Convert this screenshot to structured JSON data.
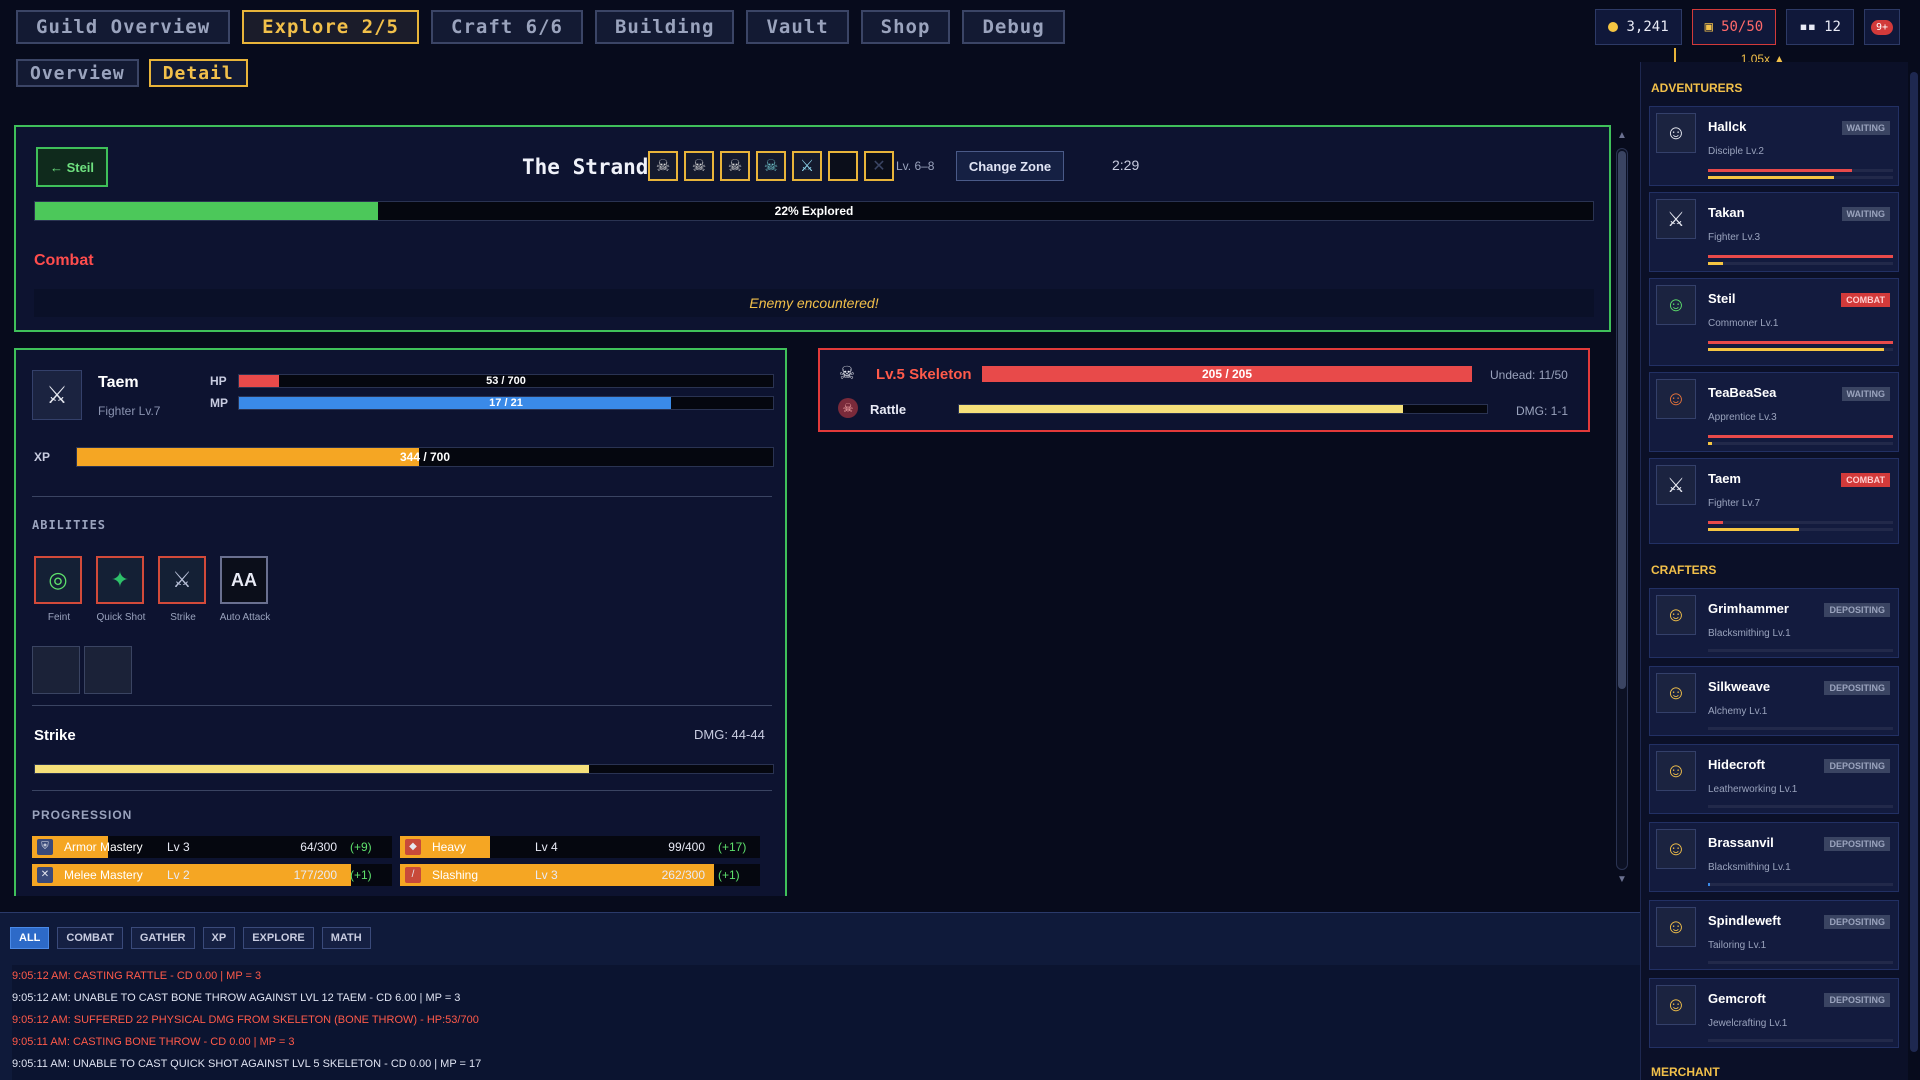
{
  "nav": {
    "tabs": [
      {
        "label": "Guild Overview",
        "active": false
      },
      {
        "label": "Explore 2/5",
        "active": true
      },
      {
        "label": "Craft 6/6",
        "active": false
      },
      {
        "label": "Building",
        "active": false
      },
      {
        "label": "Vault",
        "active": false
      },
      {
        "label": "Shop",
        "active": false
      },
      {
        "label": "Debug",
        "active": false
      }
    ],
    "subtabs": [
      {
        "label": "Overview",
        "active": false
      },
      {
        "label": "Detail",
        "active": true
      }
    ]
  },
  "resources": {
    "gold": "3,241",
    "storage": "50/50",
    "members": "12",
    "notifications": "9+",
    "multiplier": "1.05x ▲"
  },
  "explore": {
    "back_label": "← Steil",
    "zone_name": "The Strand",
    "zone_level": "Lv. 6–8",
    "change_zone_label": "Change Zone",
    "timer": "2:29",
    "explored_pct": 22,
    "explored_label": "22% Explored",
    "state_label": "Combat",
    "event_text": "Enemy encountered!",
    "monster_slots": [
      "skeleton-icon",
      "skeleton-icon",
      "skeleton-icon",
      "ghoul-icon",
      "sword-icon",
      "empty",
      "empty-x"
    ]
  },
  "hero": {
    "name": "Taem",
    "class": "Fighter Lv.7",
    "hp": {
      "label": "HP",
      "current": 53,
      "max": 700,
      "text": "53 / 700"
    },
    "mp": {
      "label": "MP",
      "current": 17,
      "max": 21,
      "text": "17 / 21"
    },
    "xp": {
      "label": "XP",
      "current": 344,
      "max": 700,
      "text": "344 / 700"
    },
    "abilities_title": "ABILITIES",
    "abilities": [
      {
        "name": "Feint",
        "icon": "spiral-icon"
      },
      {
        "name": "Quick Shot",
        "icon": "star-icon"
      },
      {
        "name": "Strike",
        "icon": "sword-icon"
      },
      {
        "name": "Auto Attack",
        "icon": "AA"
      }
    ],
    "current_action": "Strike",
    "current_dmg": "DMG: 44-44",
    "action_progress": 0.75,
    "progression_title": "PROGRESSION",
    "progression": [
      {
        "name": "Armor Mastery",
        "level": "Lv 3",
        "xp": "64/300",
        "gain": "(+9)",
        "pct": 0.21
      },
      {
        "name": "Heavy",
        "level": "Lv 4",
        "xp": "99/400",
        "gain": "(+17)",
        "pct": 0.25
      },
      {
        "name": "Melee Mastery",
        "level": "Lv 2",
        "xp": "177/200",
        "gain": "(+1)",
        "pct": 0.885
      },
      {
        "name": "Slashing",
        "level": "Lv 3",
        "xp": "262/300",
        "gain": "(+1)",
        "pct": 0.873
      }
    ]
  },
  "enemy": {
    "name": "Lv.5 Skeleton",
    "hp_text": "205 / 205",
    "hp_pct": 1.0,
    "type_info": "Undead: 11/50",
    "action": "Rattle",
    "action_progress": 0.84,
    "dmg": "DMG: 1-1"
  },
  "log": {
    "filters": [
      {
        "label": "ALL",
        "active": true
      },
      {
        "label": "COMBAT",
        "active": false
      },
      {
        "label": "GATHER",
        "active": false
      },
      {
        "label": "XP",
        "active": false
      },
      {
        "label": "EXPLORE",
        "active": false
      },
      {
        "label": "MATH",
        "active": false
      }
    ],
    "lines": [
      {
        "text": "9:05:12 AM: CASTING RATTLE - CD 0.00 | MP = 3",
        "color": "red"
      },
      {
        "text": "9:05:12 AM: UNABLE TO CAST BONE THROW AGAINST LVL 12 TAEM - CD 6.00 | MP = 3",
        "color": "white"
      },
      {
        "text": "9:05:12 AM: SUFFERED 22 PHYSICAL DMG FROM SKELETON (BONE THROW) - HP:53/700",
        "color": "red"
      },
      {
        "text": "9:05:11 AM: CASTING BONE THROW - CD 0.00 | MP = 3",
        "color": "red"
      },
      {
        "text": "9:05:11 AM: UNABLE TO CAST QUICK SHOT AGAINST LVL 5 SKELETON - CD 0.00 | MP = 17",
        "color": "white"
      }
    ]
  },
  "sidebar": {
    "adventurers_title": "ADVENTURERS",
    "adventurers": [
      {
        "name": "Hallck",
        "class": "Disciple Lv.2",
        "status": "WAITING",
        "bars": [
          0.78,
          0.68
        ]
      },
      {
        "name": "Takan",
        "class": "Fighter Lv.3",
        "status": "WAITING",
        "bars": [
          1.0,
          0.08
        ]
      },
      {
        "name": "Steil",
        "class": "Commoner Lv.1",
        "status": "COMBAT",
        "bars": [
          1.0,
          0.95
        ]
      },
      {
        "name": "TeaBeaSea",
        "class": "Apprentice Lv.3",
        "status": "WAITING",
        "bars": [
          1.0,
          0.02
        ]
      },
      {
        "name": "Taem",
        "class": "Fighter Lv.7",
        "status": "COMBAT",
        "bars": [
          0.08,
          0.49
        ]
      }
    ],
    "crafters_title": "CRAFTERS",
    "crafters": [
      {
        "name": "Grimhammer",
        "class": "Blacksmithing Lv.1",
        "status": "DEPOSITING",
        "bar": 0.0
      },
      {
        "name": "Silkweave",
        "class": "Alchemy Lv.1",
        "status": "DEPOSITING",
        "bar": 0.0
      },
      {
        "name": "Hidecroft",
        "class": "Leatherworking Lv.1",
        "status": "DEPOSITING",
        "bar": 0.0
      },
      {
        "name": "Brassanvil",
        "class": "Blacksmithing Lv.1",
        "status": "DEPOSITING",
        "bar": 0.01
      },
      {
        "name": "Spindleweft",
        "class": "Tailoring Lv.1",
        "status": "DEPOSITING",
        "bar": 0.0
      },
      {
        "name": "Gemcroft",
        "class": "Jewelcrafting Lv.1",
        "status": "DEPOSITING",
        "bar": 0.0
      }
    ],
    "merchant_title": "MERCHANT"
  },
  "colors": {
    "accent_gold": "#f2c04a",
    "explore_green": "#4cc85a",
    "hp_red": "#e84a4a",
    "mp_blue": "#3a8ae8",
    "xp_orange": "#f5a623",
    "enemy_yellow": "#f5e07a"
  }
}
